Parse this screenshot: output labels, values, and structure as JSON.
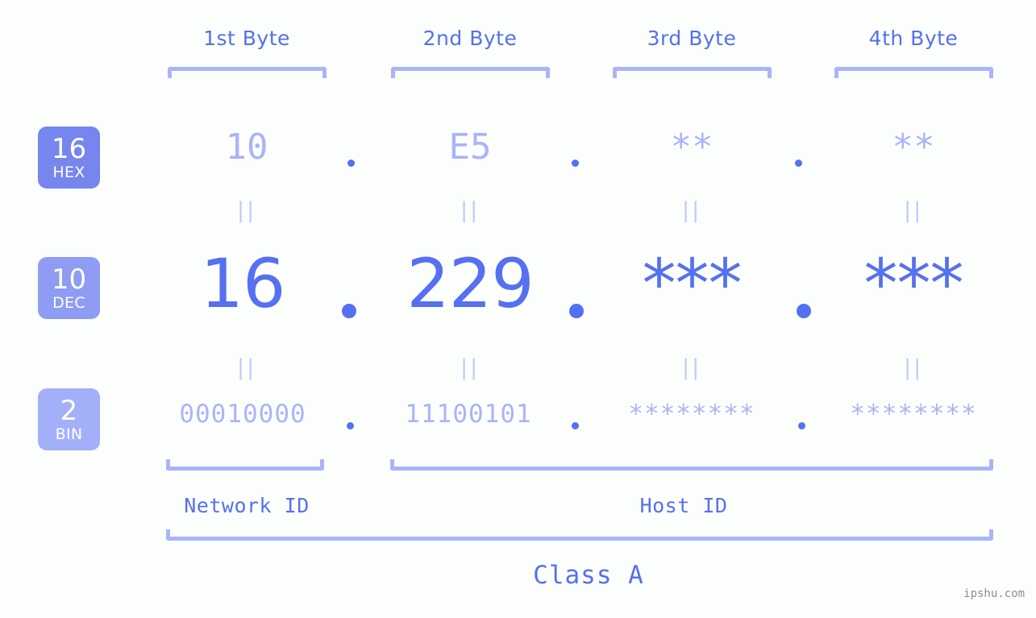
{
  "background_color": "#fcfefb",
  "accent_color": "#5570f1",
  "muted_accent_color": "#aab4fa",
  "byte_headers": [
    {
      "label": "1st Byte"
    },
    {
      "label": "2nd Byte"
    },
    {
      "label": "3rd Byte"
    },
    {
      "label": "4th Byte"
    }
  ],
  "rows": {
    "hex": {
      "base": "16",
      "system": "HEX",
      "badge_color": "#7686ee",
      "values": [
        "10",
        "E5",
        "**",
        "**"
      ],
      "separator": "."
    },
    "dec": {
      "base": "10",
      "system": "DEC",
      "badge_color": "#8e9cf4",
      "values": [
        "16",
        "229",
        "***",
        "***"
      ],
      "separator": "."
    },
    "bin": {
      "base": "2",
      "system": "BIN",
      "badge_color": "#a3b0f9",
      "values": [
        "00010000",
        "11100101",
        "********",
        "********"
      ],
      "separator": "."
    }
  },
  "equals_mark": "||",
  "footer": {
    "network_id_label": "Network ID",
    "host_id_label": "Host ID",
    "class_label": "Class A"
  },
  "watermark": "ipshu.com"
}
